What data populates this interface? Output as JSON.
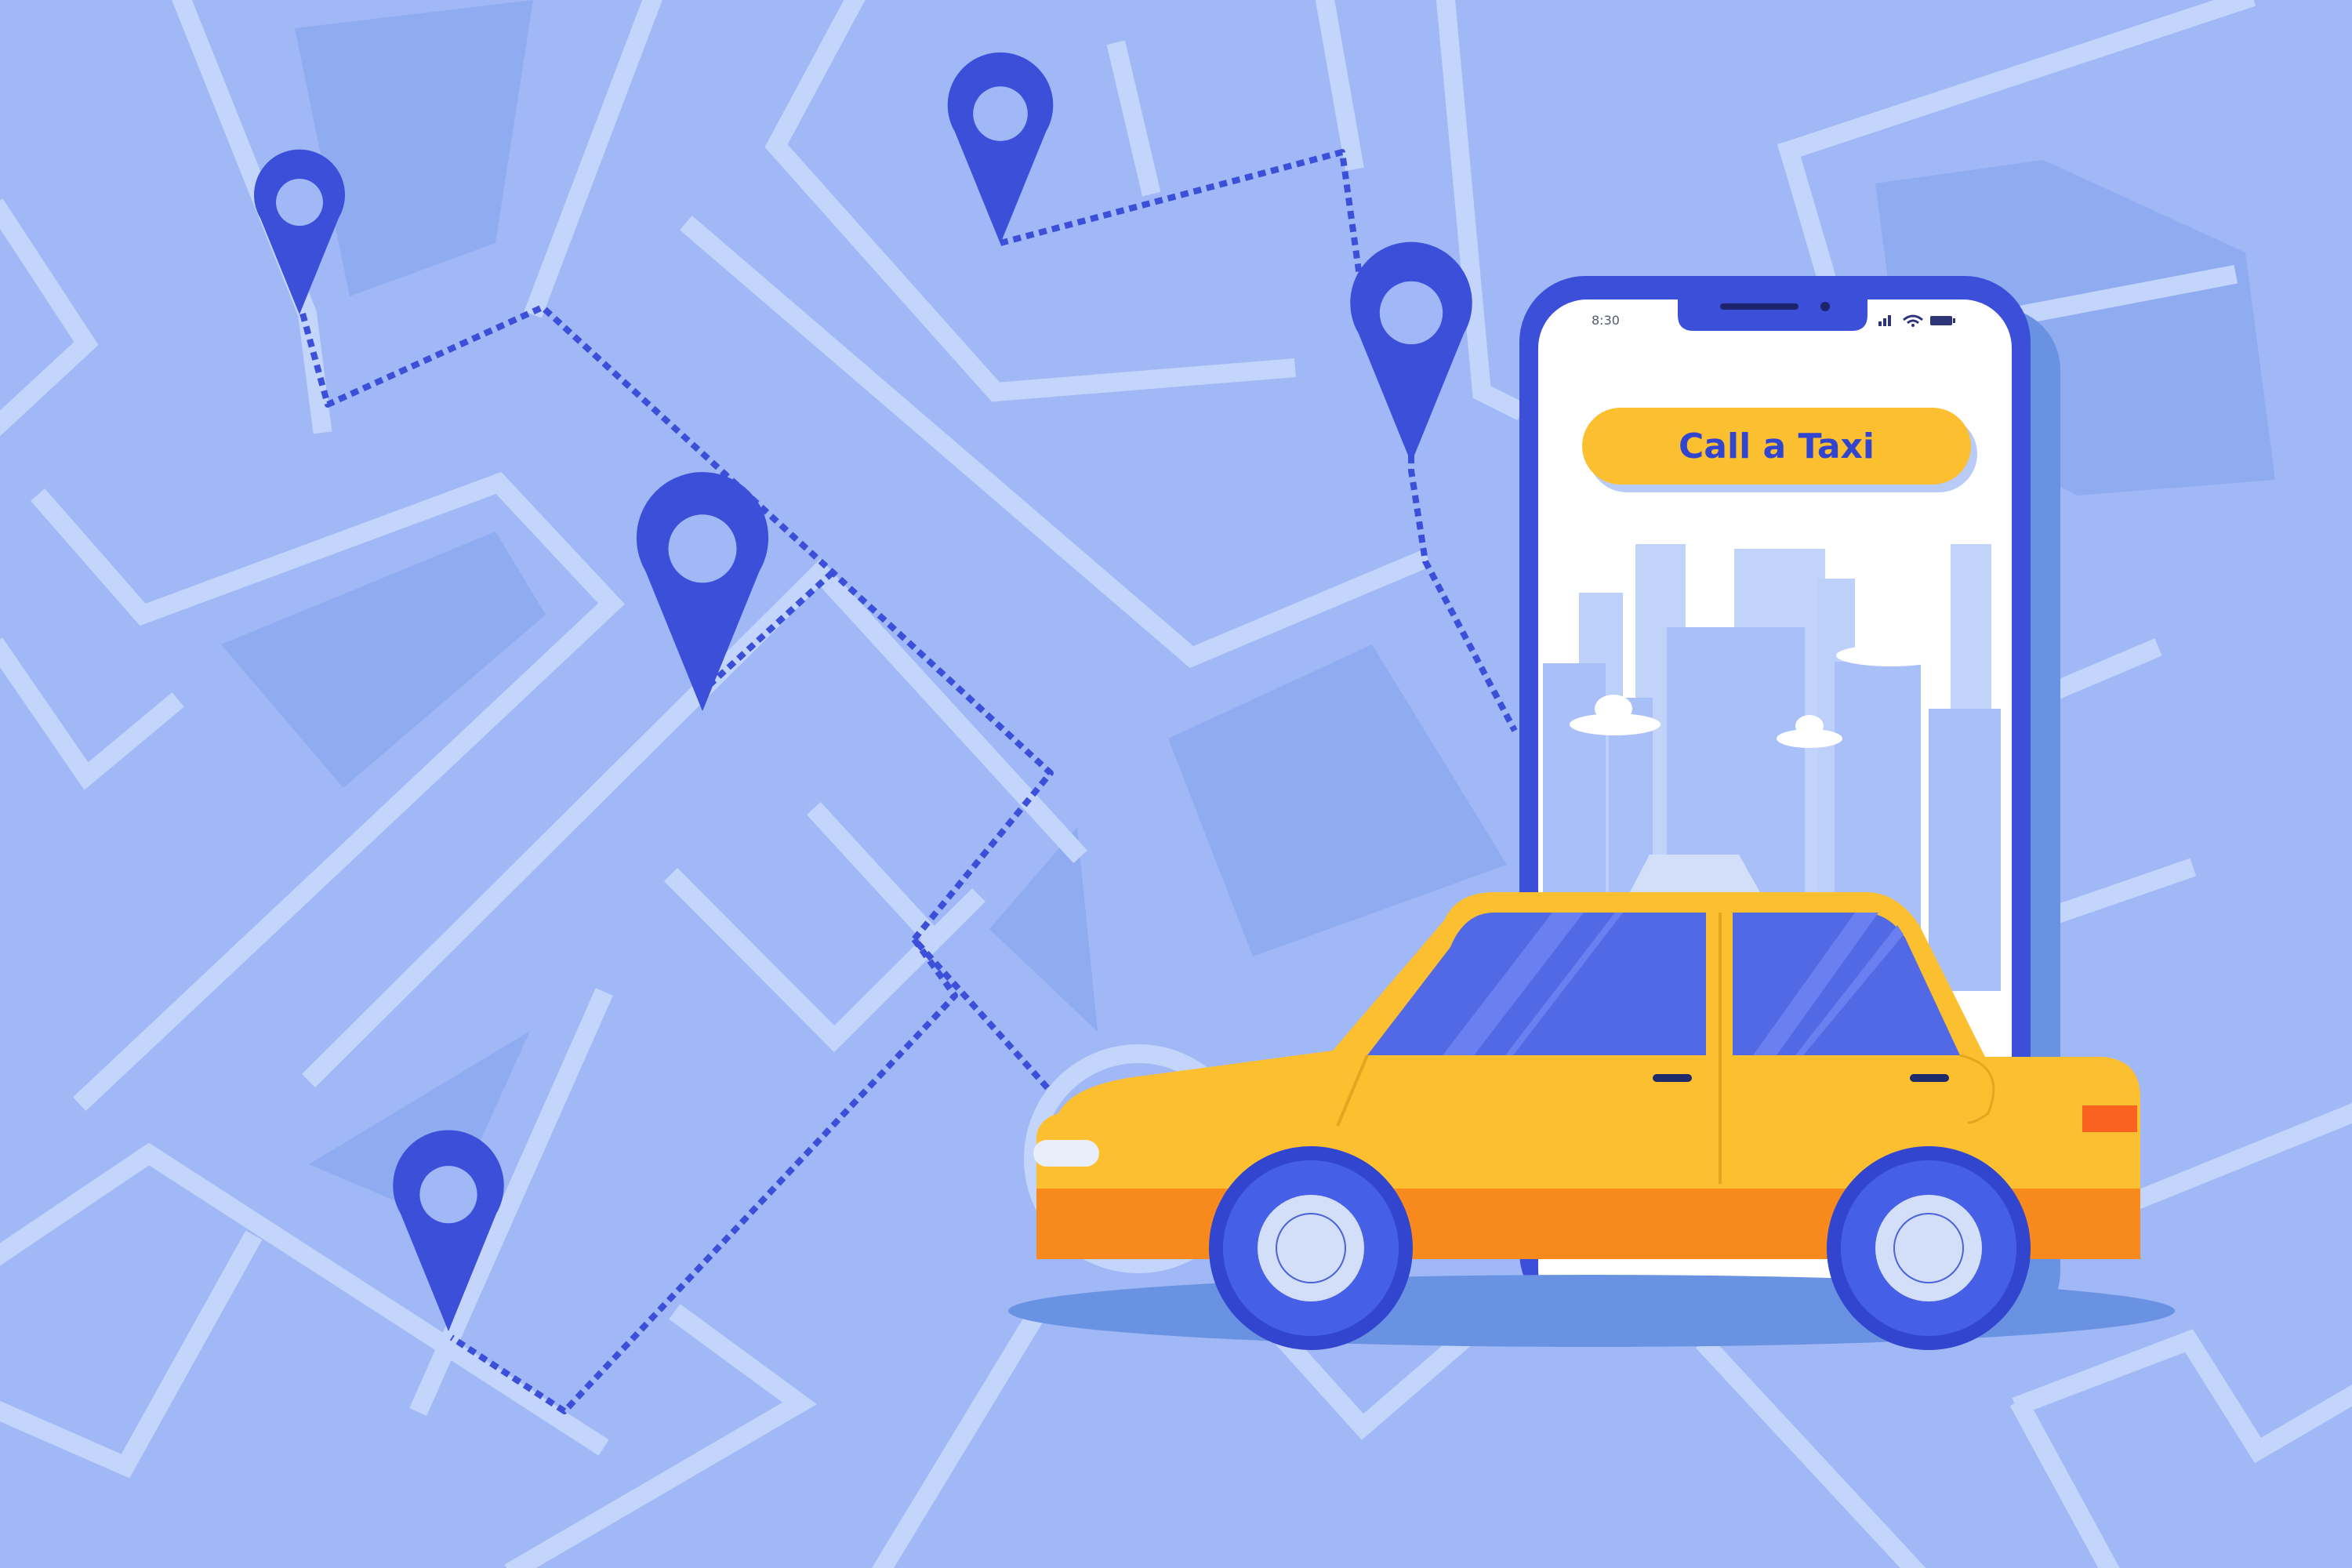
{
  "phone": {
    "status_time": "8:30",
    "call_button_label": "Call a Taxi"
  },
  "colors": {
    "map_background": "#a1b8f6",
    "road": "#c4d5fb",
    "block": "#8facf0",
    "pin": "#3b4fd9",
    "route": "#3b4fd9",
    "phone_frame": "#3b4fd9",
    "button": "#fcbf2f",
    "taxi_body": "#fcbf2f",
    "taxi_stripe": "#f88a1d",
    "window": "#5269e6"
  },
  "icons": {
    "pins": [
      "location-pin-icon",
      "location-pin-icon",
      "location-pin-icon",
      "location-pin-icon",
      "location-pin-icon"
    ],
    "status": [
      "signal-icon",
      "wifi-icon",
      "battery-icon"
    ]
  }
}
